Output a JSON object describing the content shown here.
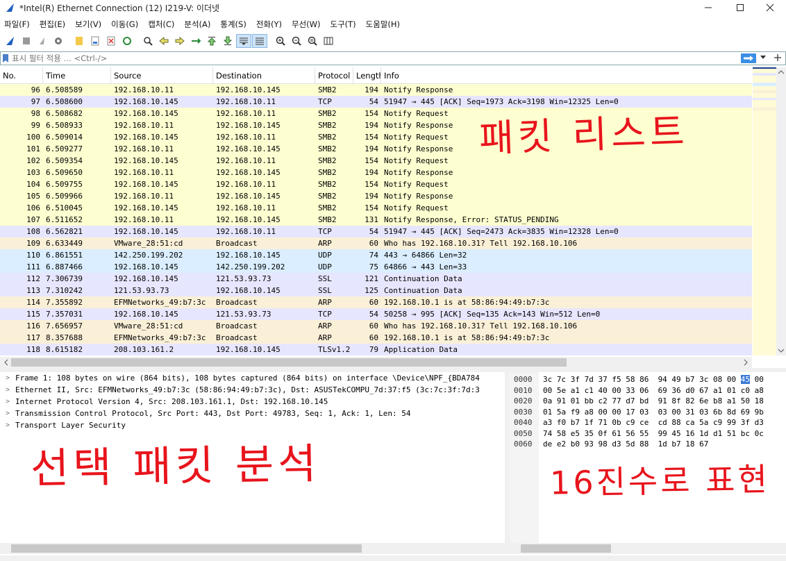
{
  "window": {
    "title": "*Intel(R) Ethernet Connection (12) I219-V: 이더넷"
  },
  "menu": [
    "파일(F)",
    "편집(E)",
    "보기(V)",
    "이동(G)",
    "캡처(C)",
    "분석(A)",
    "통계(S)",
    "전화(Y)",
    "무선(W)",
    "도구(T)",
    "도움말(H)"
  ],
  "filter": {
    "placeholder": "표시 필터 적용 … <Ctrl-/>"
  },
  "packet_list": {
    "columns": [
      "No.",
      "Time",
      "Source",
      "Destination",
      "Protocol",
      "Length",
      "Info"
    ],
    "rows": [
      {
        "no": "96",
        "time": "6.508589",
        "src": "192.168.10.11",
        "dst": "192.168.10.145",
        "proto": "SMB2",
        "len": "194",
        "info": "Notify Response",
        "bg": "#feffd0"
      },
      {
        "no": "97",
        "time": "6.508600",
        "src": "192.168.10.145",
        "dst": "192.168.10.11",
        "proto": "TCP",
        "len": "54",
        "info": "51947 → 445 [ACK] Seq=1973 Ack=3198 Win=12325 Len=0",
        "bg": "#e7e6ff"
      },
      {
        "no": "98",
        "time": "6.508682",
        "src": "192.168.10.145",
        "dst": "192.168.10.11",
        "proto": "SMB2",
        "len": "154",
        "info": "Notify Request",
        "bg": "#feffd0"
      },
      {
        "no": "99",
        "time": "6.508933",
        "src": "192.168.10.11",
        "dst": "192.168.10.145",
        "proto": "SMB2",
        "len": "194",
        "info": "Notify Response",
        "bg": "#feffd0"
      },
      {
        "no": "100",
        "time": "6.509014",
        "src": "192.168.10.145",
        "dst": "192.168.10.11",
        "proto": "SMB2",
        "len": "154",
        "info": "Notify Request",
        "bg": "#feffd0"
      },
      {
        "no": "101",
        "time": "6.509277",
        "src": "192.168.10.11",
        "dst": "192.168.10.145",
        "proto": "SMB2",
        "len": "194",
        "info": "Notify Response",
        "bg": "#feffd0"
      },
      {
        "no": "102",
        "time": "6.509354",
        "src": "192.168.10.145",
        "dst": "192.168.10.11",
        "proto": "SMB2",
        "len": "154",
        "info": "Notify Request",
        "bg": "#feffd0"
      },
      {
        "no": "103",
        "time": "6.509650",
        "src": "192.168.10.11",
        "dst": "192.168.10.145",
        "proto": "SMB2",
        "len": "194",
        "info": "Notify Response",
        "bg": "#feffd0"
      },
      {
        "no": "104",
        "time": "6.509755",
        "src": "192.168.10.145",
        "dst": "192.168.10.11",
        "proto": "SMB2",
        "len": "154",
        "info": "Notify Request",
        "bg": "#feffd0"
      },
      {
        "no": "105",
        "time": "6.509966",
        "src": "192.168.10.11",
        "dst": "192.168.10.145",
        "proto": "SMB2",
        "len": "194",
        "info": "Notify Response",
        "bg": "#feffd0"
      },
      {
        "no": "106",
        "time": "6.510045",
        "src": "192.168.10.145",
        "dst": "192.168.10.11",
        "proto": "SMB2",
        "len": "154",
        "info": "Notify Request",
        "bg": "#feffd0"
      },
      {
        "no": "107",
        "time": "6.511652",
        "src": "192.168.10.11",
        "dst": "192.168.10.145",
        "proto": "SMB2",
        "len": "131",
        "info": "Notify Response, Error: STATUS_PENDING",
        "bg": "#feffd0"
      },
      {
        "no": "108",
        "time": "6.562821",
        "src": "192.168.10.145",
        "dst": "192.168.10.11",
        "proto": "TCP",
        "len": "54",
        "info": "51947 → 445 [ACK] Seq=2473 Ack=3835 Win=12328 Len=0",
        "bg": "#e7e6ff"
      },
      {
        "no": "109",
        "time": "6.633449",
        "src": "VMware_28:51:cd",
        "dst": "Broadcast",
        "proto": "ARP",
        "len": "60",
        "info": "Who has 192.168.10.31? Tell 192.168.10.106",
        "bg": "#faf0d7"
      },
      {
        "no": "110",
        "time": "6.861551",
        "src": "142.250.199.202",
        "dst": "192.168.10.145",
        "proto": "UDP",
        "len": "74",
        "info": "443 → 64866 Len=32",
        "bg": "#daeeff"
      },
      {
        "no": "111",
        "time": "6.887466",
        "src": "192.168.10.145",
        "dst": "142.250.199.202",
        "proto": "UDP",
        "len": "75",
        "info": "64866 → 443 Len=33",
        "bg": "#daeeff"
      },
      {
        "no": "112",
        "time": "7.306739",
        "src": "192.168.10.145",
        "dst": "121.53.93.73",
        "proto": "SSL",
        "len": "121",
        "info": "Continuation Data",
        "bg": "#e7e6ff"
      },
      {
        "no": "113",
        "time": "7.310242",
        "src": "121.53.93.73",
        "dst": "192.168.10.145",
        "proto": "SSL",
        "len": "125",
        "info": "Continuation Data",
        "bg": "#e7e6ff"
      },
      {
        "no": "114",
        "time": "7.355892",
        "src": "EFMNetworks_49:b7:3c",
        "dst": "Broadcast",
        "proto": "ARP",
        "len": "60",
        "info": "192.168.10.1 is at 58:86:94:49:b7:3c",
        "bg": "#faf0d7"
      },
      {
        "no": "115",
        "time": "7.357031",
        "src": "192.168.10.145",
        "dst": "121.53.93.73",
        "proto": "TCP",
        "len": "54",
        "info": "50258 → 995 [ACK] Seq=135 Ack=143 Win=512 Len=0",
        "bg": "#e7e6ff"
      },
      {
        "no": "116",
        "time": "7.656957",
        "src": "VMware_28:51:cd",
        "dst": "Broadcast",
        "proto": "ARP",
        "len": "60",
        "info": "Who has 192.168.10.31? Tell 192.168.10.106",
        "bg": "#faf0d7"
      },
      {
        "no": "117",
        "time": "8.357688",
        "src": "EFMNetworks_49:b7:3c",
        "dst": "Broadcast",
        "proto": "ARP",
        "len": "60",
        "info": "192.168.10.1 is at 58:86:94:49:b7:3c",
        "bg": "#faf0d7"
      },
      {
        "no": "118",
        "time": "8.615182",
        "src": "208.103.161.2",
        "dst": "192.168.10.145",
        "proto": "TLSv1.2",
        "len": "79",
        "info": "Application Data",
        "bg": "#e7e6ff"
      }
    ]
  },
  "details": [
    "Frame 1: 108 bytes on wire (864 bits), 108 bytes captured (864 bits) on interface \\Device\\NPF_{BDA784",
    "Ethernet II, Src: EFMNetworks_49:b7:3c (58:86:94:49:b7:3c), Dst: ASUSTekCOMPU_7d:37:f5 (3c:7c:3f:7d:3",
    "Internet Protocol Version 4, Src: 208.103.161.1, Dst: 192.168.10.145",
    "Transmission Control Protocol, Src Port: 443, Dst Port: 49783, Seq: 1, Ack: 1, Len: 54",
    "Transport Layer Security"
  ],
  "hex": [
    {
      "off": "0000",
      "pre": "3c 7c 3f 7d 37 f5 58 86  94 49 b7 3c 08 00 ",
      "hl": "45",
      "post": " 00"
    },
    {
      "off": "0010",
      "pre": "00 5e a1 c1 40 00 33 06  69 36 d0 67 a1 01 c0 a8",
      "hl": "",
      "post": ""
    },
    {
      "off": "0020",
      "pre": "0a 91 01 bb c2 77 d7 bd  91 8f 82 6e b8 a1 50 18",
      "hl": "",
      "post": ""
    },
    {
      "off": "0030",
      "pre": "01 5a f9 a8 00 00 17 03  03 00 31 03 6b 8d 69 9b",
      "hl": "",
      "post": ""
    },
    {
      "off": "0040",
      "pre": "a3 f0 b7 1f 71 0b c9 ce  cd 88 ca 5a c9 99 3f d3",
      "hl": "",
      "post": ""
    },
    {
      "off": "0050",
      "pre": "74 58 e5 35 0f 61 56 55  99 45 16 1d d1 51 bc 0c",
      "hl": "",
      "post": ""
    },
    {
      "off": "0060",
      "pre": "de e2 b0 93 98 d3 5d 88  1d b7 18 67",
      "hl": "",
      "post": ""
    }
  ],
  "annotations": {
    "packet_list_note": "패킷 리스트",
    "details_note": "선택 패킷 분석",
    "hex_note": "16진수로 표현",
    "color": "#e8141c"
  }
}
